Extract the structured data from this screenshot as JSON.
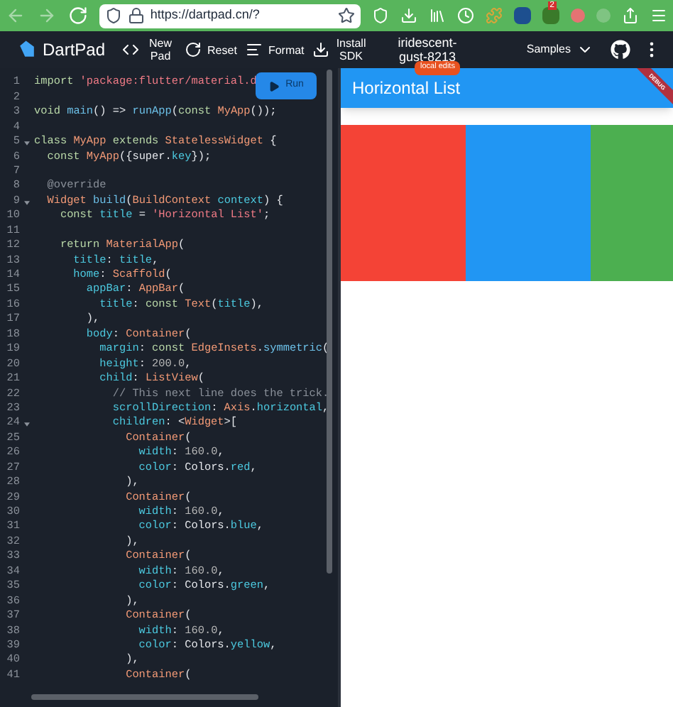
{
  "browser": {
    "url": "https://dartpad.cn/?",
    "extension_badge": "2"
  },
  "toolbar": {
    "app_name": "DartPad",
    "buttons": [
      {
        "kind": "new",
        "label": "New Pad"
      },
      {
        "kind": "reset",
        "label": "Reset"
      },
      {
        "kind": "format",
        "label": "Format"
      },
      {
        "kind": "install",
        "label": "Install SDK"
      }
    ],
    "project": [
      "iridescent-",
      "gust-8213"
    ],
    "badge": "local edits",
    "samples": "Samples"
  },
  "editor": {
    "run_button": "Run",
    "lines": [
      {
        "num": "1",
        "fold": false,
        "segments": [
          {
            "kind": "k",
            "text": "import "
          },
          {
            "kind": "s",
            "text": "'package:flutter/material.d"
          }
        ]
      },
      {
        "num": "2",
        "fold": false
      },
      {
        "num": "3",
        "fold": false,
        "segments": [
          {
            "kind": "k",
            "text": "void "
          },
          {
            "kind": "f",
            "text": "main"
          },
          {
            "kind": "x",
            "text": "() => "
          },
          {
            "kind": "f",
            "text": "runApp"
          },
          {
            "kind": "x",
            "text": "("
          },
          {
            "kind": "k",
            "text": "const "
          },
          {
            "kind": "t",
            "text": "MyApp"
          },
          {
            "kind": "x",
            "text": "());"
          }
        ]
      },
      {
        "num": "4",
        "fold": false
      },
      {
        "num": "5",
        "fold": true,
        "segments": [
          {
            "kind": "k",
            "text": "class "
          },
          {
            "kind": "t",
            "text": "MyApp"
          },
          {
            "kind": "k",
            "text": " extends "
          },
          {
            "kind": "t",
            "text": "StatelessWidget"
          },
          {
            "kind": "x",
            "text": " {"
          }
        ]
      },
      {
        "num": "6",
        "fold": false,
        "segments": [
          {
            "kind": "k",
            "text": "  const "
          },
          {
            "kind": "t",
            "text": "MyApp"
          },
          {
            "kind": "x",
            "text": "({super."
          },
          {
            "kind": "p",
            "text": "key"
          },
          {
            "kind": "x",
            "text": "});"
          }
        ]
      },
      {
        "num": "7",
        "fold": false
      },
      {
        "num": "8",
        "fold": false,
        "segments": [
          {
            "kind": "c",
            "text": "  @override"
          }
        ]
      },
      {
        "num": "9",
        "fold": true,
        "segments": [
          {
            "kind": "t",
            "text": "  Widget "
          },
          {
            "kind": "f",
            "text": "build"
          },
          {
            "kind": "x",
            "text": "("
          },
          {
            "kind": "t",
            "text": "BuildContext "
          },
          {
            "kind": "p",
            "text": "context"
          },
          {
            "kind": "x",
            "text": ") {"
          }
        ]
      },
      {
        "num": "10",
        "fold": false,
        "segments": [
          {
            "kind": "k",
            "text": "    const "
          },
          {
            "kind": "p",
            "text": "title"
          },
          {
            "kind": "x",
            "text": " = "
          },
          {
            "kind": "s",
            "text": "'Horizontal List'"
          },
          {
            "kind": "x",
            "text": ";"
          }
        ]
      },
      {
        "num": "11",
        "fold": false
      },
      {
        "num": "12",
        "fold": false,
        "segments": [
          {
            "kind": "k",
            "text": "    return "
          },
          {
            "kind": "t",
            "text": "MaterialApp"
          },
          {
            "kind": "x",
            "text": "("
          }
        ]
      },
      {
        "num": "13",
        "fold": false,
        "segments": [
          {
            "kind": "p",
            "text": "      title"
          },
          {
            "kind": "x",
            "text": ": "
          },
          {
            "kind": "p",
            "text": "title"
          },
          {
            "kind": "x",
            "text": ","
          }
        ]
      },
      {
        "num": "14",
        "fold": false,
        "segments": [
          {
            "kind": "p",
            "text": "      home"
          },
          {
            "kind": "x",
            "text": ": "
          },
          {
            "kind": "t",
            "text": "Scaffold"
          },
          {
            "kind": "x",
            "text": "("
          }
        ]
      },
      {
        "num": "15",
        "fold": false,
        "segments": [
          {
            "kind": "p",
            "text": "        appBar"
          },
          {
            "kind": "x",
            "text": ": "
          },
          {
            "kind": "t",
            "text": "AppBar"
          },
          {
            "kind": "x",
            "text": "("
          }
        ]
      },
      {
        "num": "16",
        "fold": false,
        "segments": [
          {
            "kind": "p",
            "text": "          title"
          },
          {
            "kind": "x",
            "text": ": "
          },
          {
            "kind": "k",
            "text": "const "
          },
          {
            "kind": "t",
            "text": "Text"
          },
          {
            "kind": "x",
            "text": "("
          },
          {
            "kind": "p",
            "text": "title"
          },
          {
            "kind": "x",
            "text": "),"
          }
        ]
      },
      {
        "num": "17",
        "fold": false,
        "segments": [
          {
            "kind": "x",
            "text": "        ),"
          }
        ]
      },
      {
        "num": "18",
        "fold": false,
        "segments": [
          {
            "kind": "p",
            "text": "        body"
          },
          {
            "kind": "x",
            "text": ": "
          },
          {
            "kind": "t",
            "text": "Container"
          },
          {
            "kind": "x",
            "text": "("
          }
        ]
      },
      {
        "num": "19",
        "fold": false,
        "segments": [
          {
            "kind": "p",
            "text": "          margin"
          },
          {
            "kind": "x",
            "text": ": "
          },
          {
            "kind": "k",
            "text": "const "
          },
          {
            "kind": "t",
            "text": "EdgeInsets"
          },
          {
            "kind": "x",
            "text": "."
          },
          {
            "kind": "f",
            "text": "symmetric"
          },
          {
            "kind": "x",
            "text": "("
          }
        ]
      },
      {
        "num": "20",
        "fold": false,
        "segments": [
          {
            "kind": "p",
            "text": "          height"
          },
          {
            "kind": "x",
            "text": ": "
          },
          {
            "kind": "n",
            "text": "200.0"
          },
          {
            "kind": "x",
            "text": ","
          }
        ]
      },
      {
        "num": "21",
        "fold": false,
        "segments": [
          {
            "kind": "p",
            "text": "          child"
          },
          {
            "kind": "x",
            "text": ": "
          },
          {
            "kind": "t",
            "text": "ListView"
          },
          {
            "kind": "x",
            "text": "("
          }
        ]
      },
      {
        "num": "22",
        "fold": false,
        "segments": [
          {
            "kind": "c",
            "text": "            // This next line does the trick."
          }
        ]
      },
      {
        "num": "23",
        "fold": false,
        "segments": [
          {
            "kind": "p",
            "text": "            scrollDirection"
          },
          {
            "kind": "x",
            "text": ": "
          },
          {
            "kind": "t",
            "text": "Axis"
          },
          {
            "kind": "x",
            "text": "."
          },
          {
            "kind": "p",
            "text": "horizontal"
          },
          {
            "kind": "x",
            "text": ","
          }
        ]
      },
      {
        "num": "24",
        "fold": true,
        "segments": [
          {
            "kind": "p",
            "text": "            children"
          },
          {
            "kind": "x",
            "text": ": <"
          },
          {
            "kind": "t",
            "text": "Widget"
          },
          {
            "kind": "x",
            "text": ">["
          }
        ]
      },
      {
        "num": "25",
        "fold": false,
        "segments": [
          {
            "kind": "t",
            "text": "              Container"
          },
          {
            "kind": "x",
            "text": "("
          }
        ]
      },
      {
        "num": "26",
        "fold": false,
        "segments": [
          {
            "kind": "p",
            "text": "                width"
          },
          {
            "kind": "x",
            "text": ": "
          },
          {
            "kind": "n",
            "text": "160.0"
          },
          {
            "kind": "x",
            "text": ","
          }
        ]
      },
      {
        "num": "27",
        "fold": false,
        "segments": [
          {
            "kind": "p",
            "text": "                color"
          },
          {
            "kind": "x",
            "text": ": Colors."
          },
          {
            "kind": "p",
            "text": "red"
          },
          {
            "kind": "x",
            "text": ","
          }
        ]
      },
      {
        "num": "28",
        "fold": false,
        "segments": [
          {
            "kind": "x",
            "text": "              ),"
          }
        ]
      },
      {
        "num": "29",
        "fold": false,
        "segments": [
          {
            "kind": "t",
            "text": "              Container"
          },
          {
            "kind": "x",
            "text": "("
          }
        ]
      },
      {
        "num": "30",
        "fold": false,
        "segments": [
          {
            "kind": "p",
            "text": "                width"
          },
          {
            "kind": "x",
            "text": ": "
          },
          {
            "kind": "n",
            "text": "160.0"
          },
          {
            "kind": "x",
            "text": ","
          }
        ]
      },
      {
        "num": "31",
        "fold": false,
        "segments": [
          {
            "kind": "p",
            "text": "                color"
          },
          {
            "kind": "x",
            "text": ": Colors."
          },
          {
            "kind": "p",
            "text": "blue"
          },
          {
            "kind": "x",
            "text": ","
          }
        ]
      },
      {
        "num": "32",
        "fold": false,
        "segments": [
          {
            "kind": "x",
            "text": "              ),"
          }
        ]
      },
      {
        "num": "33",
        "fold": false,
        "segments": [
          {
            "kind": "t",
            "text": "              Container"
          },
          {
            "kind": "x",
            "text": "("
          }
        ]
      },
      {
        "num": "34",
        "fold": false,
        "segments": [
          {
            "kind": "p",
            "text": "                width"
          },
          {
            "kind": "x",
            "text": ": "
          },
          {
            "kind": "n",
            "text": "160.0"
          },
          {
            "kind": "x",
            "text": ","
          }
        ]
      },
      {
        "num": "35",
        "fold": false,
        "segments": [
          {
            "kind": "p",
            "text": "                color"
          },
          {
            "kind": "x",
            "text": ": Colors."
          },
          {
            "kind": "p",
            "text": "green"
          },
          {
            "kind": "x",
            "text": ","
          }
        ]
      },
      {
        "num": "36",
        "fold": false,
        "segments": [
          {
            "kind": "x",
            "text": "              ),"
          }
        ]
      },
      {
        "num": "37",
        "fold": false,
        "segments": [
          {
            "kind": "t",
            "text": "              Container"
          },
          {
            "kind": "x",
            "text": "("
          }
        ]
      },
      {
        "num": "38",
        "fold": false,
        "segments": [
          {
            "kind": "p",
            "text": "                width"
          },
          {
            "kind": "x",
            "text": ": "
          },
          {
            "kind": "n",
            "text": "160.0"
          },
          {
            "kind": "x",
            "text": ","
          }
        ]
      },
      {
        "num": "39",
        "fold": false,
        "segments": [
          {
            "kind": "p",
            "text": "                color"
          },
          {
            "kind": "x",
            "text": ": Colors."
          },
          {
            "kind": "p",
            "text": "yellow"
          },
          {
            "kind": "x",
            "text": ","
          }
        ]
      },
      {
        "num": "40",
        "fold": false,
        "segments": [
          {
            "kind": "x",
            "text": "              ),"
          }
        ]
      },
      {
        "num": "41",
        "fold": false,
        "segments": [
          {
            "kind": "t",
            "text": "              Container"
          },
          {
            "kind": "x",
            "text": "("
          }
        ]
      }
    ]
  },
  "preview": {
    "app_bar_title": "Horizontal List",
    "debug_banner": "DEBUG",
    "tiles": [
      {
        "color": "#f44336"
      },
      {
        "color": "#2196f3"
      },
      {
        "color": "#4caf50"
      }
    ]
  }
}
